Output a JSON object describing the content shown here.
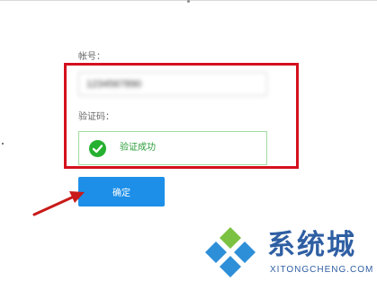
{
  "form": {
    "account_label": "帐号：",
    "account_value": "1234567890",
    "captcha_label": "验证码：",
    "captcha_status": "验证成功",
    "confirm_button_label": "确定"
  },
  "watermark": {
    "brand": "系统城",
    "url": "XITONGCHENG.COM"
  },
  "colors": {
    "highlight_frame": "#d4101d",
    "button": "#1d8fe8",
    "success": "#26b02f",
    "brand": "#2f5fa3"
  }
}
